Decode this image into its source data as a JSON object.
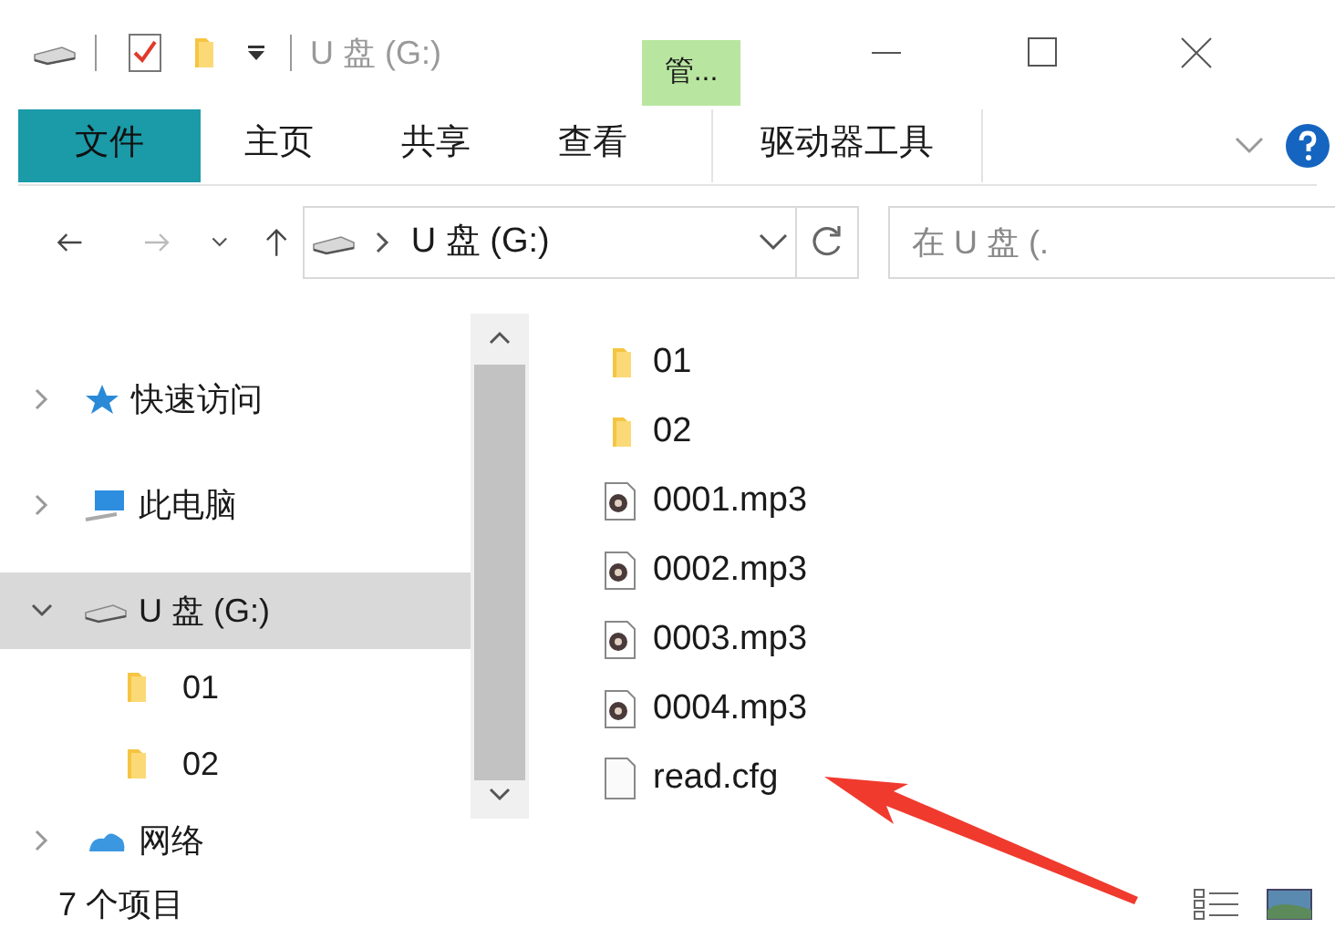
{
  "window": {
    "title": "U 盘 (G:)",
    "context_label": "管..."
  },
  "ribbon_tabs": [
    {
      "label": "文件",
      "kind": "file"
    },
    {
      "label": "主页",
      "kind": "tab"
    },
    {
      "label": "共享",
      "kind": "tab"
    },
    {
      "label": "查看",
      "kind": "tab"
    },
    {
      "label": "驱动器工具",
      "kind": "context"
    }
  ],
  "address": {
    "path": "U 盘 (G:)",
    "search_placeholder": "在 U 盘 (."
  },
  "nav_tree": [
    {
      "label": "快速访问",
      "kind": "star",
      "expanded": false,
      "selected": false
    },
    {
      "label": "此电脑",
      "kind": "pc",
      "expanded": false,
      "selected": false
    },
    {
      "label": "U 盘 (G:)",
      "kind": "drive",
      "expanded": true,
      "selected": true,
      "children": [
        {
          "label": "01",
          "kind": "folder",
          "selected": false
        },
        {
          "label": "02",
          "kind": "folder",
          "selected": false
        }
      ]
    },
    {
      "label": "网络",
      "kind": "network",
      "expanded": false,
      "selected": false
    }
  ],
  "files": [
    {
      "name": "01",
      "kind": "folder"
    },
    {
      "name": "02",
      "kind": "folder"
    },
    {
      "name": "0001.mp3",
      "kind": "audio"
    },
    {
      "name": "0002.mp3",
      "kind": "audio"
    },
    {
      "name": "0003.mp3",
      "kind": "audio"
    },
    {
      "name": "0004.mp3",
      "kind": "audio"
    },
    {
      "name": "read.cfg",
      "kind": "file"
    }
  ],
  "status_bar": {
    "count": "7 个项目"
  }
}
